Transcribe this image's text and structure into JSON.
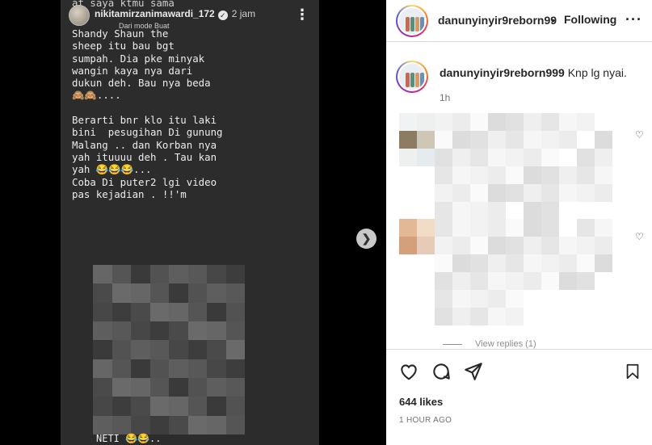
{
  "story": {
    "username": "nikitamirzanimawardi_172",
    "time": "2 jam",
    "sub_label": "Dari mode Buat",
    "text_top": "at saya ktmu sama",
    "text": "Shandy Shaun the\nsheep itu bau bgt\nsumpah. Dia pke minyak\nwangin kaya nya dari\ndukun deh. Bau nya beda\n🙈🙈....\n\nBerarti bnr klo itu laki\nbini  pesugihan Di gunung\nMalang .. dan Korban nya\nyah ituuuu deh . Tau kan\nyah 😂😂😂...\nCoba Di puter2 lgi video\npas kejadian . !!'m",
    "footer": "NETI 😂😂.."
  },
  "post": {
    "username": "danunyinyir9reborn99",
    "separator": "•",
    "follow_label": "Following",
    "more_label": "···"
  },
  "caption": {
    "username": "danunyinyir9reborn999",
    "text": "Knp lg nyai.",
    "time": "1h"
  },
  "comments": {
    "view_replies": "View replies (1)"
  },
  "actions": {
    "likes": "644 likes",
    "posted": "1 HOUR AGO"
  },
  "colors": {
    "panel_bg": "#ffffff",
    "text": "#262626",
    "muted": "#737373",
    "story_bg": "#2c2c2c"
  },
  "icons": [
    "like-icon",
    "comment-icon",
    "share-icon",
    "save-icon",
    "next-arrow-icon",
    "heart-icon",
    "verified-icon",
    "more-icon"
  ]
}
